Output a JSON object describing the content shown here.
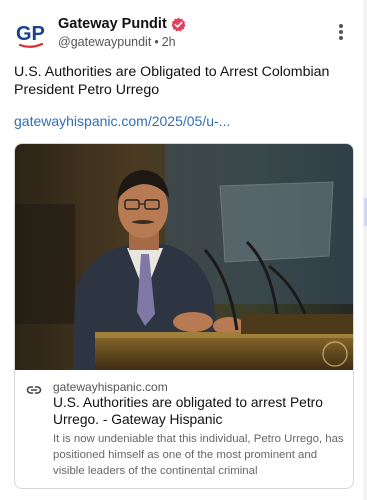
{
  "post": {
    "author_name": "Gateway Pundit",
    "handle": "@gatewaypundit",
    "separator": "•",
    "time": "2h",
    "avatar_text": "GP",
    "text": "U.S. Authorities are Obligated to Arrest Colombian President Petro Urrego",
    "link_text": "gatewayhispanic.com/2025/05/u-..."
  },
  "card": {
    "domain": "gatewayhispanic.com",
    "title": "U.S. Authorities are obligated to arrest Petro Urrego. - Gateway Hispanic",
    "description": "It is now undeniable that this individual, Petro Urrego, has positioned himself as one of the most prominent and visible leaders of the continental criminal"
  },
  "icons": {
    "verified": "verified-badge-icon",
    "more": "more-options-icon",
    "link": "link-icon"
  },
  "colors": {
    "link": "#2f6fb4",
    "brand_blue": "#1d3f8f",
    "brand_red": "#e02b2b",
    "verified": "#e2405b"
  }
}
